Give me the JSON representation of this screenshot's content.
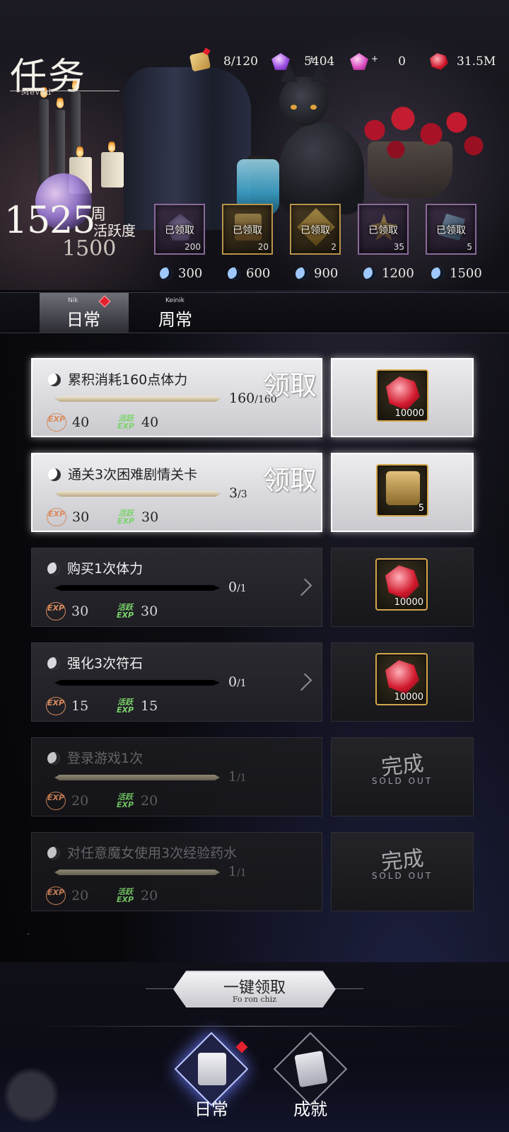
{
  "header": {
    "title": "任务",
    "subtitle": "Mevnd",
    "currencies": [
      {
        "icon": "scroll-icon",
        "value": "8/120"
      },
      {
        "icon": "purple-gem-icon",
        "value": "5404"
      },
      {
        "icon": "pink-gem-icon",
        "value": "0"
      },
      {
        "icon": "red-gem-icon",
        "value": "31.5M"
      }
    ]
  },
  "activity": {
    "value": "1525",
    "week_label": "周",
    "label": "活跃度",
    "max": "1500",
    "milestones": [
      {
        "status": "已领取",
        "count": "200",
        "threshold": "300"
      },
      {
        "status": "已领取",
        "count": "20",
        "threshold": "600"
      },
      {
        "status": "已领取",
        "count": "2",
        "threshold": "900"
      },
      {
        "status": "已领取",
        "count": "35",
        "threshold": "1200"
      },
      {
        "status": "已领取",
        "count": "5",
        "threshold": "1500"
      }
    ]
  },
  "tabs": [
    {
      "sub": "Nik",
      "label": "日常"
    },
    {
      "sub": "Keinik",
      "label": "周常"
    }
  ],
  "quests": [
    {
      "name": "累积消耗160点体力",
      "current": "160",
      "total": "/160",
      "progress": 1.0,
      "exp": "40",
      "act": "40",
      "state": "claim",
      "action": "领取",
      "reward_count": "10000"
    },
    {
      "name": "通关3次困难剧情关卡",
      "current": "3",
      "total": "/3",
      "progress": 1.0,
      "exp": "30",
      "act": "30",
      "state": "claim",
      "action": "领取",
      "reward_count": "5"
    },
    {
      "name": "购买1次体力",
      "current": "0",
      "total": "/1",
      "progress": 0.0,
      "exp": "30",
      "act": "30",
      "state": "todo",
      "reward_count": "10000"
    },
    {
      "name": "强化3次符石",
      "current": "0",
      "total": "/1",
      "progress": 0.0,
      "exp": "15",
      "act": "15",
      "state": "todo",
      "reward_count": "10000"
    },
    {
      "name": "登录游戏1次",
      "current": "1",
      "total": "/1",
      "progress": 1.0,
      "exp": "20",
      "act": "20",
      "state": "done",
      "done_label": "完成",
      "done_sub": "SOLD OUT"
    },
    {
      "name": "对任意魔女使用3次经验药水",
      "current": "1",
      "total": "/1",
      "progress": 1.0,
      "exp": "20",
      "act": "20",
      "state": "done",
      "done_label": "完成",
      "done_sub": "SOLD OUT"
    }
  ],
  "xp_badges": {
    "exp": "EXP",
    "act": "活跃 EXP"
  },
  "footer": {
    "claim_all": "一键领取",
    "claim_all_sub": "Fo ron chiz",
    "nav": [
      {
        "label": "日常",
        "icon": "scroll-icon"
      },
      {
        "label": "成就",
        "icon": "quill-scroll-icon"
      }
    ]
  },
  "colors": {
    "accent_red": "#e3202e",
    "gold": "#d2a64a",
    "activity_green": "#7bd36a",
    "exp_orange": "#d98a5c"
  }
}
